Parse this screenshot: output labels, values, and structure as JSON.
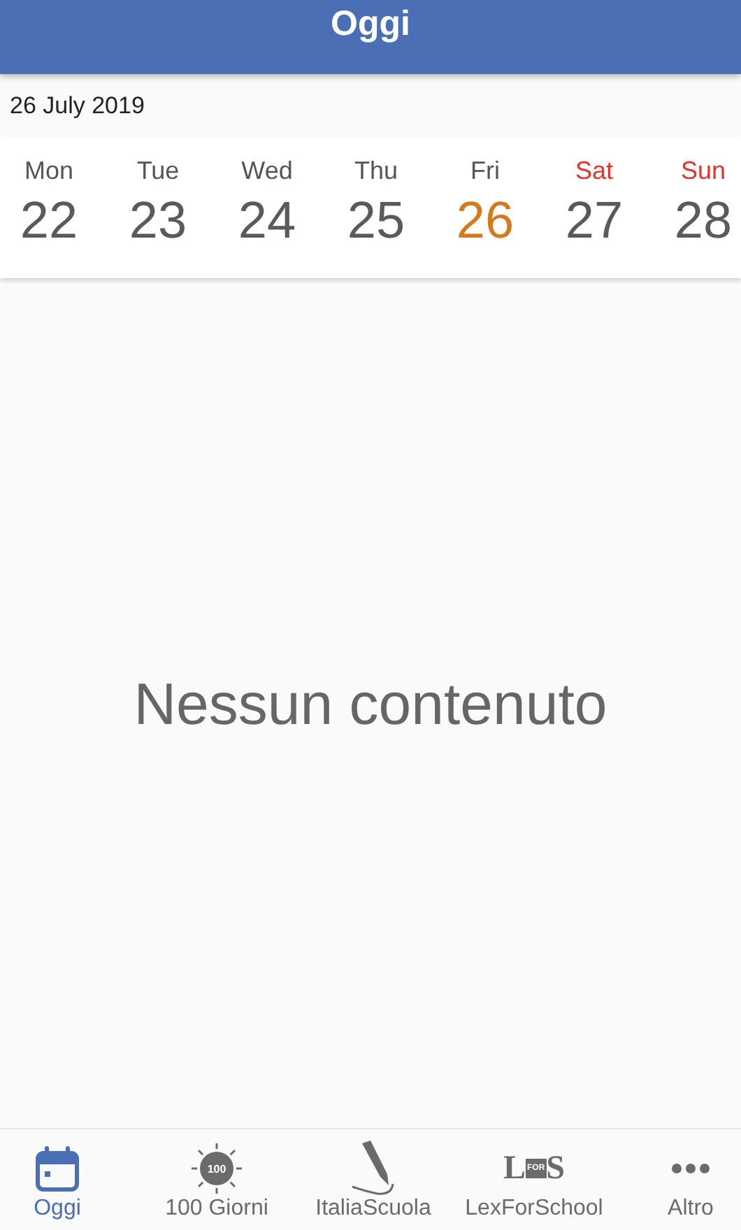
{
  "header": {
    "title": "Oggi"
  },
  "date_label": "26 July 2019",
  "days": [
    {
      "weekday": "Mon",
      "day": "22",
      "weekend": false,
      "selected": false
    },
    {
      "weekday": "Tue",
      "day": "23",
      "weekend": false,
      "selected": false
    },
    {
      "weekday": "Wed",
      "day": "24",
      "weekend": false,
      "selected": false
    },
    {
      "weekday": "Thu",
      "day": "25",
      "weekend": false,
      "selected": false
    },
    {
      "weekday": "Fri",
      "day": "26",
      "weekend": false,
      "selected": true
    },
    {
      "weekday": "Sat",
      "day": "27",
      "weekend": true,
      "selected": false
    },
    {
      "weekday": "Sun",
      "day": "28",
      "weekend": true,
      "selected": false
    }
  ],
  "empty_message": "Nessun contenuto",
  "nav": [
    {
      "kind": "calendar",
      "label": "Oggi",
      "selected": true
    },
    {
      "kind": "badge",
      "label": "100 Giorni",
      "icon_text": "100",
      "selected": false
    },
    {
      "kind": "pen",
      "label": "ItaliaScuola",
      "selected": false
    },
    {
      "kind": "logo",
      "label": "LexForSchool",
      "logo_parts": [
        "L",
        "FOR",
        "S"
      ],
      "selected": false
    },
    {
      "kind": "more",
      "label": "Altro",
      "selected": false
    }
  ]
}
